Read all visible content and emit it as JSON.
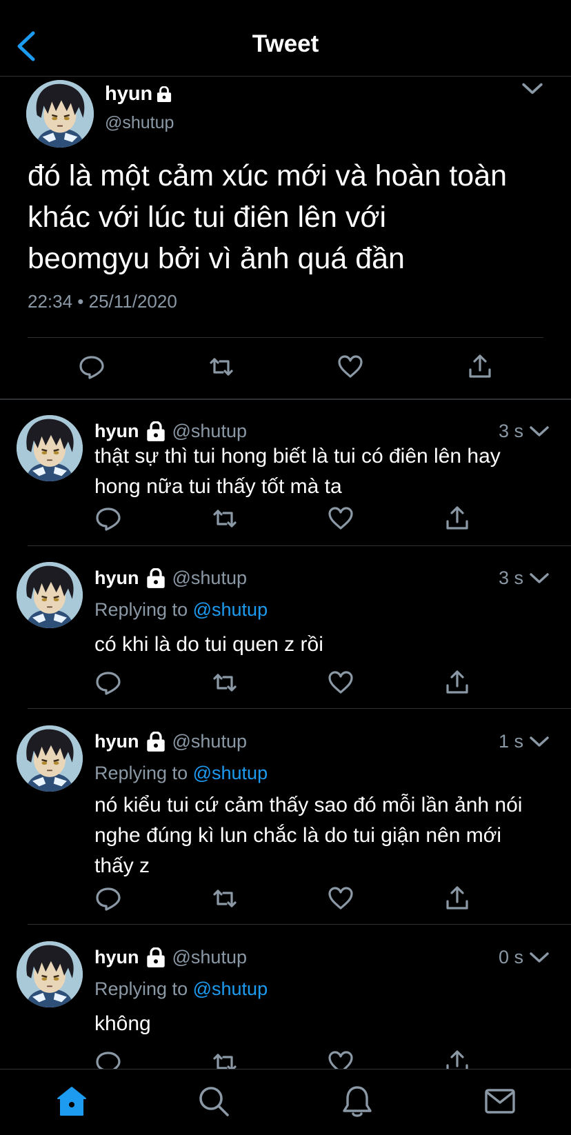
{
  "header": {
    "title": "Tweet",
    "back_icon": "back-chevron-icon",
    "accent": "#1d9bf0"
  },
  "main_tweet": {
    "name": "hyun",
    "handle": "@shutup",
    "text": "đó là một cảm xúc mới và hoàn toàn\nkhác với lúc tui điên lên với\nbeomgyu bởi vì ảnh quá đần",
    "timestamp": "22:34 • 25/11/2020"
  },
  "replies": [
    {
      "name": "hyun",
      "handle": "@shutup",
      "time": "3 s",
      "replying_label": "",
      "replying_to": "",
      "text": "thật sự thì tui hong biết là tui có điên lên hay\nhong nữa tui thấy tốt mà ta"
    },
    {
      "name": "hyun",
      "handle": "@shutup",
      "time": "3 s",
      "replying_label": "Replying to",
      "replying_to": "@shutup",
      "text": "có khi là do tui quen z rồi"
    },
    {
      "name": "hyun",
      "handle": "@shutup",
      "time": "1 s",
      "replying_label": "Replying to",
      "replying_to": "@shutup",
      "text": "nó kiểu tui cứ cảm thấy sao đó mỗi lần ảnh nói\nnghe đúng kì lun chắc là do tui giận nên mới\nthấy z"
    },
    {
      "name": "hyun",
      "handle": "@shutup",
      "time": "0 s",
      "replying_label": "Replying to",
      "replying_to": "@shutup",
      "text": "không"
    }
  ],
  "bottom_nav": {
    "items": [
      "home-icon",
      "search-icon",
      "notifications-icon",
      "messages-icon"
    ],
    "active": "home-icon"
  },
  "colors": {
    "background": "#000000",
    "secondary_text": "#8b98a5",
    "divider": "#2f3336",
    "link": "#1d9bf0"
  }
}
